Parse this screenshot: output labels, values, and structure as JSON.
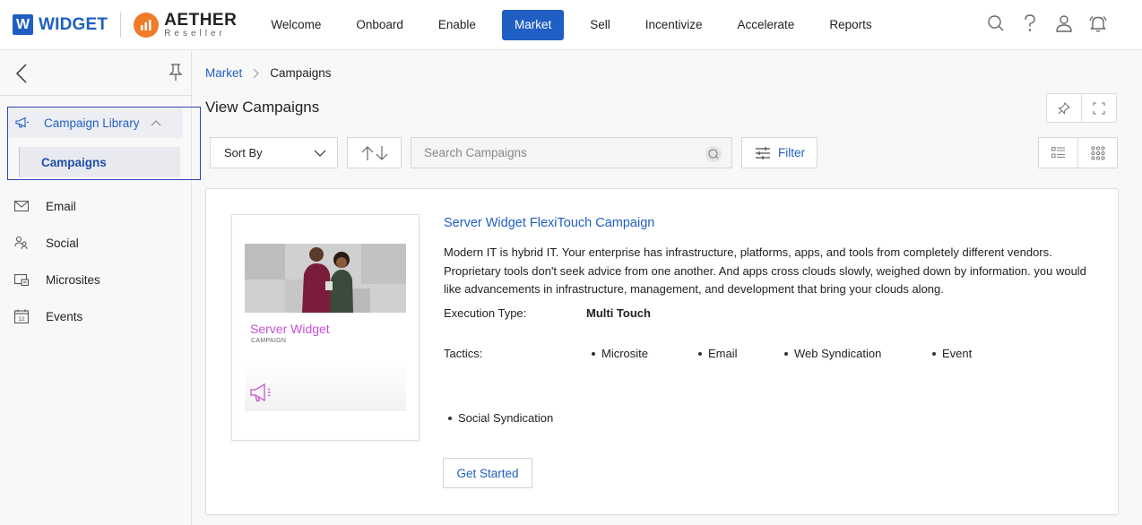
{
  "header": {
    "brand_mark": "W",
    "brand_name": "WIDGET",
    "partner_name": "AETHER",
    "partner_sub": "Reseller",
    "nav": [
      "Welcome",
      "Onboard",
      "Enable",
      "Market",
      "Sell",
      "Incentivize",
      "Accelerate",
      "Reports"
    ],
    "active_nav": "Market",
    "icons": [
      "search-icon",
      "help-icon",
      "user-icon",
      "bell-icon"
    ],
    "accent": "#1f5fc4",
    "partner_color": "#f07b28"
  },
  "sidebar": {
    "library_label": "Campaign Library",
    "sub_item": "Campaigns",
    "items": [
      {
        "label": "Email",
        "icon": "envelope-icon"
      },
      {
        "label": "Social",
        "icon": "social-icon"
      },
      {
        "label": "Microsites",
        "icon": "microsite-icon"
      },
      {
        "label": "Events",
        "icon": "calendar-icon"
      }
    ]
  },
  "breadcrumb": {
    "root": "Market",
    "current": "Campaigns"
  },
  "page_title": "View Campaigns",
  "toolbar": {
    "sort_label": "Sort By",
    "search_placeholder": "Search Campaigns",
    "filter_label": "Filter"
  },
  "campaign": {
    "title": "Server Widget FlexiTouch Campaign",
    "description": "Modern IT is hybrid IT. Your enterprise has infrastructure, platforms, apps, and tools from completely different vendors. Proprietary tools don't seek advice from one another. And apps cross clouds slowly, weighed down by information. you would like advancements in infrastructure, management, and development that bring your clouds along.",
    "execution_label": "Execution Type:",
    "execution_value": "Multi Touch",
    "tactics_label": "Tactics:",
    "tactics": [
      "Microsite",
      "Email",
      "Web Syndication",
      "Event",
      "Social Syndication"
    ],
    "thumb_title": "Server Widget",
    "thumb_sub": "CAMPAIGN",
    "thumb_color": "#c94fd8",
    "cta": "Get Started"
  },
  "calendar_day": "12"
}
